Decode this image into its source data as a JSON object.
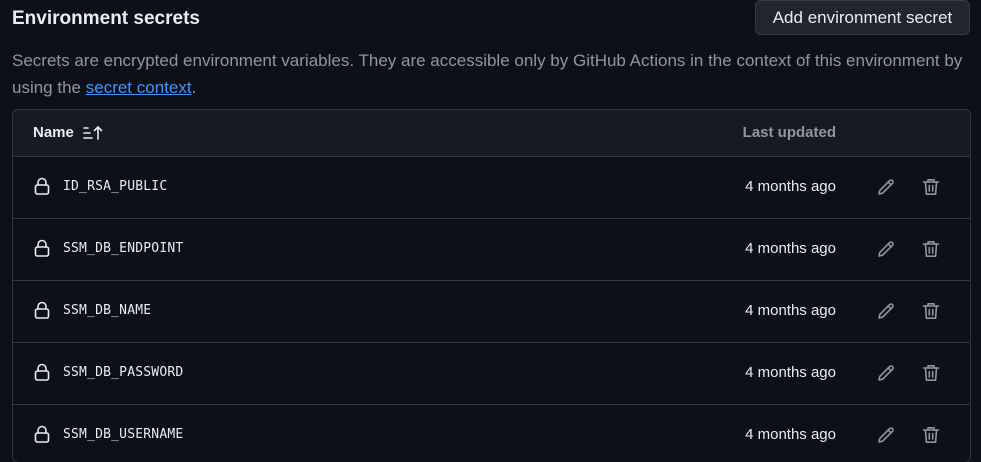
{
  "header": {
    "title": "Environment secrets",
    "add_button_label": "Add environment secret"
  },
  "description": {
    "text_before_link": "Secrets are encrypted environment variables. They are accessible only by GitHub Actions in the context of this environment by using the ",
    "link_text": "secret context",
    "text_after_link": "."
  },
  "table": {
    "columns": {
      "name": "Name",
      "last_updated": "Last updated"
    },
    "rows": [
      {
        "name": "ID_RSA_PUBLIC",
        "updated": "4 months ago"
      },
      {
        "name": "SSM_DB_ENDPOINT",
        "updated": "4 months ago"
      },
      {
        "name": "SSM_DB_NAME",
        "updated": "4 months ago"
      },
      {
        "name": "SSM_DB_PASSWORD",
        "updated": "4 months ago"
      },
      {
        "name": "SSM_DB_USERNAME",
        "updated": "4 months ago"
      }
    ]
  },
  "icons": {
    "sort": "sort-ascending-icon",
    "lock": "lock-icon",
    "edit": "pencil-icon",
    "delete": "trash-icon"
  },
  "colors": {
    "background": "#0d1117",
    "header_bg": "#161b22",
    "border": "#30363d",
    "text": "#e6edf3",
    "muted": "#8d96a0",
    "link": "#4493f8",
    "button_bg": "#21262d"
  }
}
